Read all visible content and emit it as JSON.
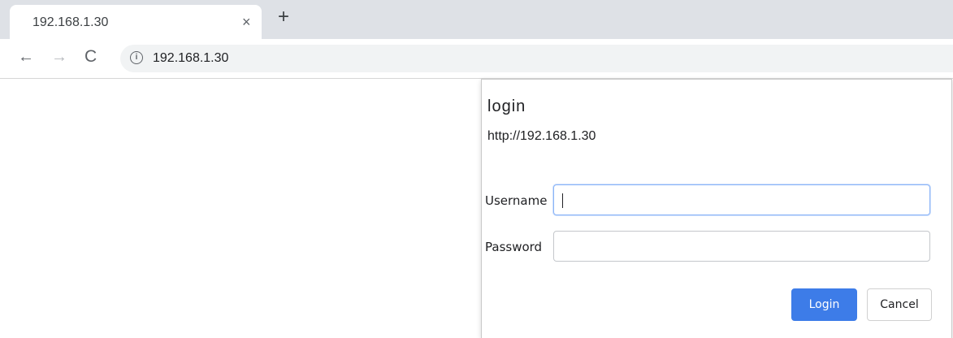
{
  "browser": {
    "tab": {
      "title": "192.168.1.30",
      "close_glyph": "×"
    },
    "new_tab_glyph": "+",
    "toolbar": {
      "back_glyph": "←",
      "forward_glyph": "→",
      "reload_glyph": "C",
      "info_glyph": "i",
      "url": "192.168.1.30"
    }
  },
  "dialog": {
    "title": "login",
    "origin": "http://192.168.1.30",
    "username_label": "Username",
    "username_value": "",
    "password_label": "Password",
    "password_value": "",
    "login_label": "Login",
    "cancel_label": "Cancel"
  },
  "colors": {
    "primary_button": "#3d7ce8",
    "focus_ring": "#8ab4f8",
    "tabstrip": "#dee1e6"
  }
}
